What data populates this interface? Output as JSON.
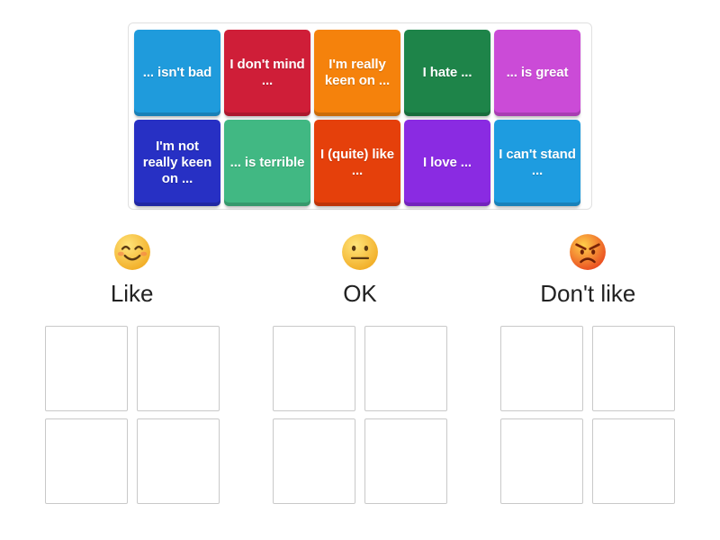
{
  "activity": {
    "type": "group-sort",
    "title": "Group sort"
  },
  "tray": {
    "rows": [
      [
        {
          "label": "... isn't bad",
          "color": "#1f9bdc",
          "name": "tile-isnt-bad"
        },
        {
          "label": "I don't mind ...",
          "color": "#cf1e38",
          "name": "tile-dont-mind"
        },
        {
          "label": "I'm really keen on ...",
          "color": "#f5820c",
          "name": "tile-really-keen-on"
        },
        {
          "label": "I hate ...",
          "color": "#1e8449",
          "name": "tile-hate"
        },
        {
          "label": "... is great",
          "color": "#cb4bd7",
          "name": "tile-is-great"
        }
      ],
      [
        {
          "label": "I'm not really keen on ...",
          "color": "#2730c4",
          "name": "tile-not-really-keen-on"
        },
        {
          "label": "... is terrible",
          "color": "#41b883",
          "name": "tile-is-terrible"
        },
        {
          "label": "I (quite) like ...",
          "color": "#e5400b",
          "name": "tile-quite-like"
        },
        {
          "label": "I love ...",
          "color": "#8a2be2",
          "name": "tile-love"
        },
        {
          "label": "I can't stand ...",
          "color": "#1e9ce0",
          "name": "tile-cant-stand"
        }
      ]
    ]
  },
  "categories": [
    {
      "label": "Like",
      "emoji": "smiling-face-with-smiling-eyes-emoji",
      "emoji_char": "😊",
      "zone_rows": 2,
      "zones_per_row": 2
    },
    {
      "label": "OK",
      "emoji": "neutral-face-emoji",
      "emoji_char": "😐",
      "zone_rows": 2,
      "zones_per_row": 2
    },
    {
      "label": "Don't like",
      "emoji": "angry-face-emoji",
      "emoji_char": "😡",
      "zone_rows": 2,
      "zones_per_row": 2
    }
  ],
  "colors": {
    "background": "#ffffff",
    "tray_border": "#e0e0e0",
    "dropzone_border": "#c9c9c9",
    "label_text": "#222222",
    "tile_text": "#ffffff"
  }
}
